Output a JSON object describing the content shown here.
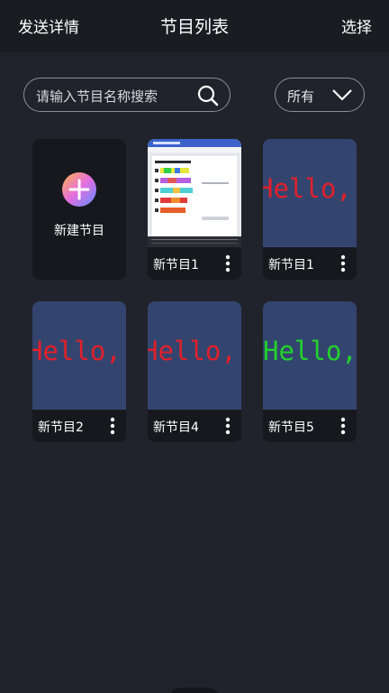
{
  "header": {
    "left": "发送详情",
    "title": "节目列表",
    "right": "选择"
  },
  "search": {
    "placeholder": "请输入节目名称搜索"
  },
  "filter": {
    "value": "所有"
  },
  "new_program": {
    "label": "新建节目"
  },
  "programs": [
    {
      "name": "新节目1"
    },
    {
      "name": "新节目1",
      "preview_text": "Hello,",
      "preview_color": "#e0202a"
    },
    {
      "name": "新节目2",
      "preview_text": "Hello,",
      "preview_color": "#e0202a"
    },
    {
      "name": "新节目4",
      "preview_text": "Hello,",
      "preview_color": "#e0202a"
    },
    {
      "name": "新节目5",
      "preview_text": "Hello,",
      "preview_color": "#22d12b"
    }
  ],
  "colors": {
    "background": "#20232b",
    "card": "#17181d",
    "preview_bg": "#33456f"
  }
}
